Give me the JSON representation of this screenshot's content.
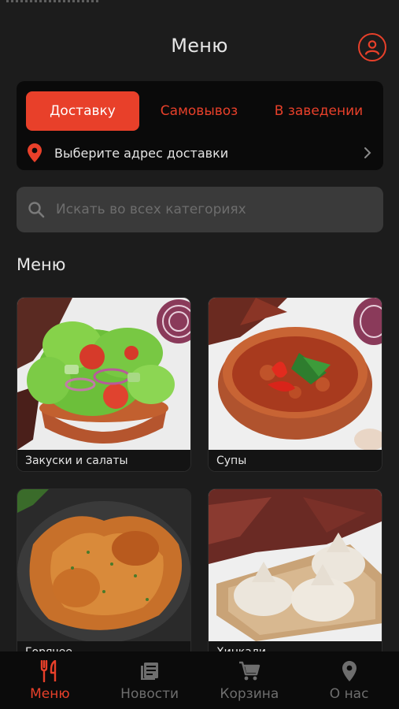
{
  "header": {
    "title": "Меню"
  },
  "delivery": {
    "tabs": [
      {
        "label": "Доставку",
        "active": true
      },
      {
        "label": "Самовывоз",
        "active": false
      },
      {
        "label": "В заведении",
        "active": false
      }
    ],
    "address_prompt": "Выберите адрес доставки"
  },
  "search": {
    "placeholder": "Искать во всех категориях"
  },
  "menu_section": {
    "title": "Меню"
  },
  "categories": [
    {
      "name": "Закуски и салаты",
      "image": "salad-photo"
    },
    {
      "name": "Супы",
      "image": "soup-photo"
    },
    {
      "name": "Горячее",
      "image": "grilled-chicken-photo"
    },
    {
      "name": "Хинкали",
      "image": "khinkali-photo"
    }
  ],
  "bottom_nav": [
    {
      "label": "Меню",
      "icon": "fork-knife-icon",
      "active": true
    },
    {
      "label": "Новости",
      "icon": "news-icon",
      "active": false
    },
    {
      "label": "Корзина",
      "icon": "cart-icon",
      "active": false
    },
    {
      "label": "О нас",
      "icon": "location-pin-icon",
      "active": false
    }
  ],
  "colors": {
    "accent": "#e8402a",
    "background": "#1c1c1c",
    "card": "#0a0a0a",
    "search": "#3a3a3a"
  }
}
